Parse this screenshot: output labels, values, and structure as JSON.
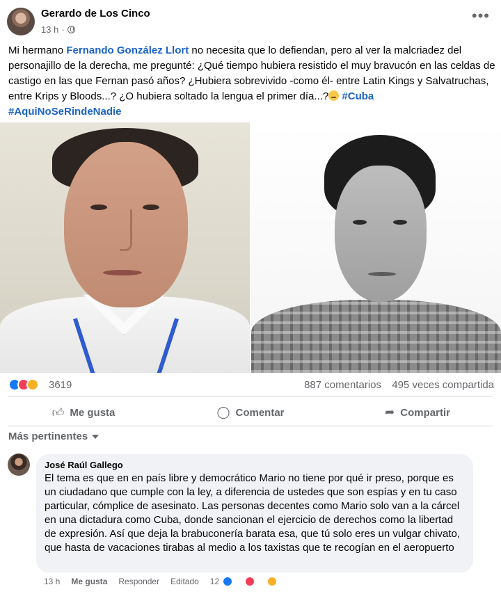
{
  "post": {
    "author": "Gerardo de Los Cinco",
    "time": "13 h",
    "separator": "·",
    "more": "•••",
    "text_1": "Mi hermano ",
    "mention": "Fernando González Llort",
    "text_2": "  no necesita que lo defiendan, pero al ver  la malcriadez del personajillo de la derecha, me pregunté: ¿Qué tiempo hubiera resistido el muy bravucón en las celdas de castigo en las que Fernan pasó años? ¿Hubiera sobrevivido -como él- entre Latin Kings y Salvatruchas, entre Krips y Bloods...? ¿O hubiera soltado la lengua el primer día...?",
    "tag_1": "#Cuba",
    "tag_2": "#AquiNoSeRindeNadie"
  },
  "stats": {
    "reactions": "3619",
    "comments": "887 comentarios",
    "shares": "495 veces compartida"
  },
  "actions": {
    "like": "Me gusta",
    "comment": "Comentar",
    "share": "Compartir"
  },
  "comments_section": {
    "filter_label": "Más pertinentes"
  },
  "comment": {
    "author": "José Raúl Gallego",
    "text": "El tema es que en en país libre y democrático Mario no tiene por qué ir preso, porque es un ciudadano que cumple con la ley, a diferencia de ustedes que son espías y en tu caso particular, cómplice de asesinato. Las personas decentes como Mario solo van a la cárcel en una dictadura como Cuba, donde sancionan el ejercicio de derechos como la libertad de expresión. Así que deja la brabuconería barata esa, que tú solo eres un vulgar chivato, que hasta de vacaciones tirabas al medio a los taxistas que te recogían en el aeropuerto",
    "time": "13 h",
    "like": "Me gusta",
    "reply": "Responder",
    "edited": "Editado",
    "reaction_count": "12"
  },
  "colors": {
    "link": "#1b63c6",
    "secondary_text": "#65676b",
    "bubble": "#f0f2f5",
    "like_blue": "#1877f2",
    "love_red": "#f33e58",
    "care_yellow": "#f7b125"
  },
  "icons": {
    "globe": "globe-icon",
    "like": "thumbs-up-icon",
    "comment": "speech-bubble-icon",
    "share": "share-arrow-icon"
  }
}
